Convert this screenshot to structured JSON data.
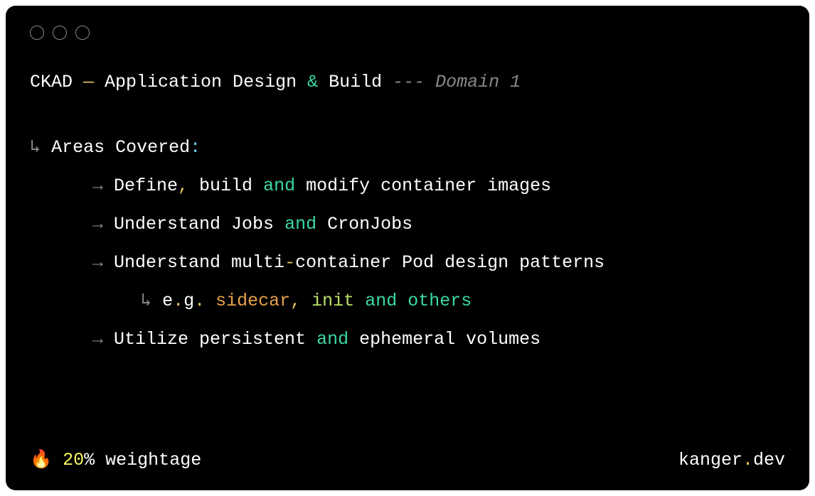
{
  "title": {
    "prefix": "CKAD",
    "dash": " — ",
    "main": "Application Design ",
    "amp": "&",
    "tail": " Build ",
    "suffix_dashes": "--- ",
    "suffix_text": "Domain 1"
  },
  "areas": {
    "arrow": "↳ ",
    "label": "Areas Covered",
    "colon": ":"
  },
  "items": [
    {
      "arrow": "→ ",
      "parts": [
        {
          "text": "Define",
          "cls": "c-white"
        },
        {
          "text": ",",
          "cls": "c-yellow"
        },
        {
          "text": " build ",
          "cls": "c-white"
        },
        {
          "text": "and",
          "cls": "c-green"
        },
        {
          "text": " modify container images",
          "cls": "c-white"
        }
      ]
    },
    {
      "arrow": "→ ",
      "parts": [
        {
          "text": "Understand Jobs ",
          "cls": "c-white"
        },
        {
          "text": "and",
          "cls": "c-green"
        },
        {
          "text": " CronJobs",
          "cls": "c-white"
        }
      ]
    },
    {
      "arrow": "→ ",
      "parts": [
        {
          "text": "Understand multi",
          "cls": "c-white"
        },
        {
          "text": "-",
          "cls": "c-yellow"
        },
        {
          "text": "container Pod design patterns",
          "cls": "c-white"
        }
      ]
    }
  ],
  "sub_item": {
    "arrow": "↳ ",
    "parts": [
      {
        "text": "e",
        "cls": "c-white"
      },
      {
        "text": ".",
        "cls": "c-yellow"
      },
      {
        "text": "g",
        "cls": "c-white"
      },
      {
        "text": ". ",
        "cls": "c-yellow"
      },
      {
        "text": "sidecar",
        "cls": "c-orange-text"
      },
      {
        "text": ", ",
        "cls": "c-yellow"
      },
      {
        "text": "init",
        "cls": "c-lime"
      },
      {
        "text": " ",
        "cls": "c-white"
      },
      {
        "text": "and",
        "cls": "c-green"
      },
      {
        "text": " ",
        "cls": "c-white"
      },
      {
        "text": "others",
        "cls": "c-teal"
      }
    ]
  },
  "item4": {
    "arrow": "→ ",
    "parts": [
      {
        "text": "Utilize persistent ",
        "cls": "c-white"
      },
      {
        "text": "and",
        "cls": "c-green"
      },
      {
        "text": " ephemeral volumes",
        "cls": "c-white"
      }
    ]
  },
  "footer": {
    "fire": "🔥",
    "percent_num": " 20",
    "percent_sign": "%",
    "weightage": " weightage",
    "site_pre": "kanger",
    "site_dot": ".",
    "site_post": "dev"
  }
}
